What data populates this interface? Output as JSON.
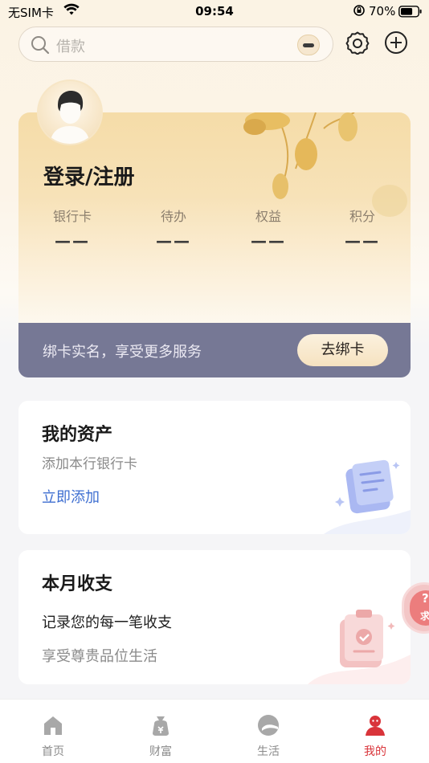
{
  "status_bar": {
    "carrier": "无SIM卡",
    "time": "09:54",
    "battery_percent": "70%",
    "battery_level": 0.7
  },
  "search": {
    "placeholder": "借款"
  },
  "profile": {
    "login_label": "登录/注册",
    "stats": [
      {
        "label": "银行卡",
        "value": "——"
      },
      {
        "label": "待办",
        "value": "——"
      },
      {
        "label": "权益",
        "value": "——"
      },
      {
        "label": "积分",
        "value": "——"
      }
    ]
  },
  "bind_banner": {
    "text": "绑卡实名，享受更多服务",
    "button_label": "去绑卡"
  },
  "assets_card": {
    "title": "我的资产",
    "subtitle": "添加本行银行卡",
    "link": "立即添加"
  },
  "budget_card": {
    "title": "本月收支",
    "line1": "记录您的每一笔收支",
    "line2": "享受尊贵品位生活"
  },
  "help_float": {
    "text": "求"
  },
  "bottom_nav": [
    {
      "label": "首页",
      "icon": "home-icon",
      "active": false
    },
    {
      "label": "财富",
      "icon": "wealth-bag-icon",
      "active": false
    },
    {
      "label": "生活",
      "icon": "life-icon",
      "active": false
    },
    {
      "label": "我的",
      "icon": "profile-icon",
      "active": true
    }
  ],
  "colors": {
    "accent_red": "#d9343a",
    "link_blue": "#3f6fd1",
    "banner_bg": "#767895",
    "card_gold": "#f5dca8"
  }
}
